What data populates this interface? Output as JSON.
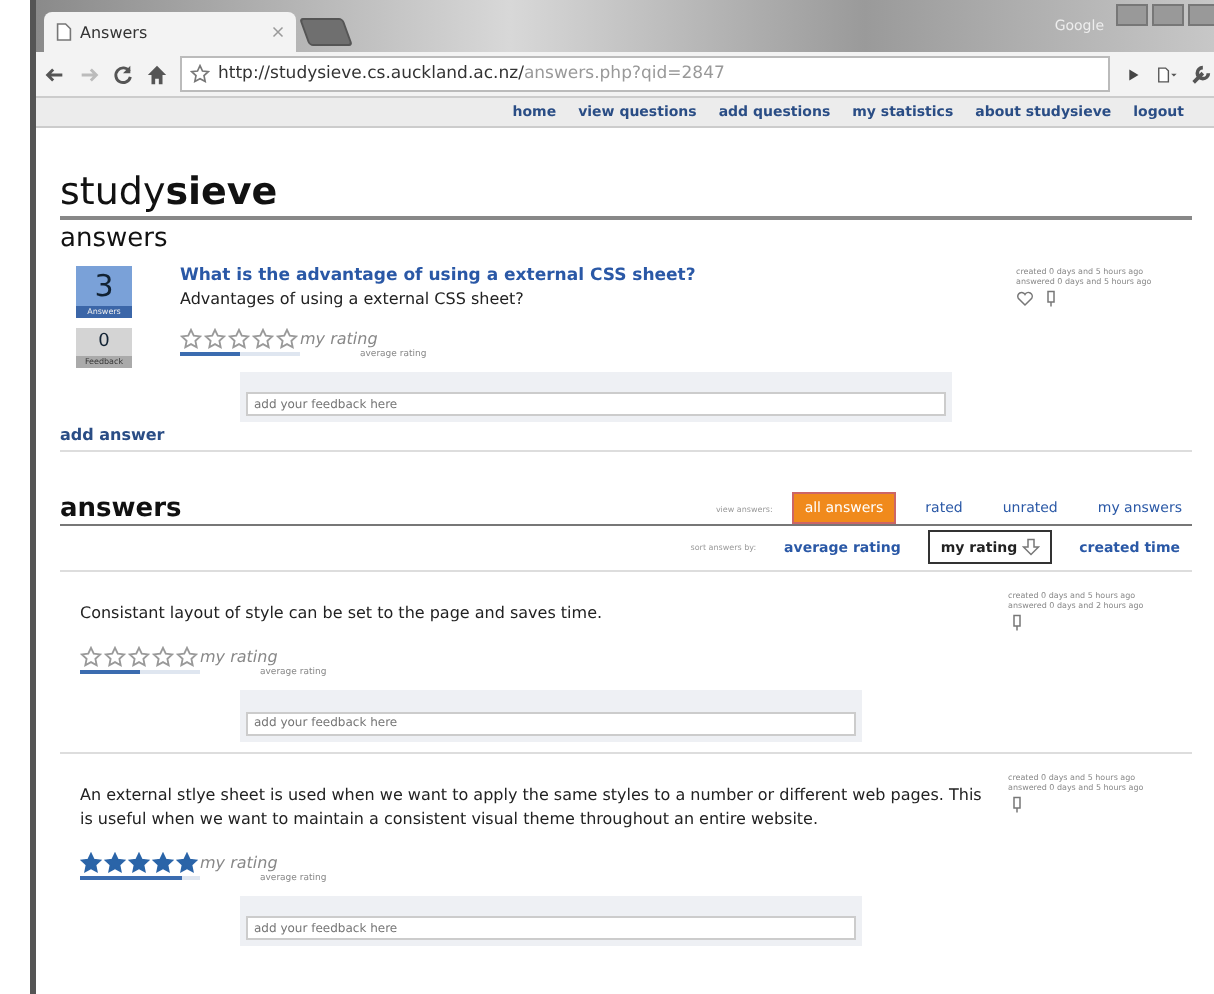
{
  "browser": {
    "tab_title": "Answers",
    "profile_label": "Google",
    "url_host": "http://studysieve.cs.auckland.ac.nz/",
    "url_path": "answers.php?qid=2847"
  },
  "nav": [
    "home",
    "view questions",
    "add questions",
    "my statistics",
    "about studysieve",
    "logout"
  ],
  "logo": "study**sieve**",
  "question_section": {
    "heading": "answers",
    "answers_count": "3",
    "answers_label": "Answers",
    "feedback_count": "0",
    "feedback_label": "Feedback",
    "title": "What is the advantage of using a external CSS sheet?",
    "body": "Advantages of using a external CSS sheet?",
    "meta": [
      "created 0 days and 5 hours ago",
      "answered 0 days and 5 hours ago"
    ],
    "stars": 0,
    "rating_label": "my rating",
    "avg_label": "average rating",
    "level": 0.5,
    "feedback": {
      "placeholder": "add your feedback here"
    },
    "add_answer": "add answer"
  },
  "answers_section": {
    "heading": "answers",
    "view_label": "view answers:",
    "view_tabs": [
      {
        "label": "all answers",
        "selected": true
      },
      {
        "label": "rated",
        "selected": false
      },
      {
        "label": "unrated",
        "selected": false
      },
      {
        "label": "my answers",
        "selected": false
      }
    ],
    "sort_label": "sort answers by:",
    "sort_options": [
      {
        "label": "average rating",
        "selected": false
      },
      {
        "label": "my rating",
        "selected": true
      },
      {
        "label": "created time",
        "selected": false
      }
    ],
    "answers": [
      {
        "text": "Consistant layout of style can be set to the page and saves time.",
        "meta": [
          "created 0 days and 5 hours ago",
          "answered 0 days and 2 hours ago"
        ],
        "stars": 0,
        "rating_label": "my rating",
        "avg_label": "average rating",
        "level": 0.5,
        "feedback": {
          "placeholder": "add your feedback here"
        }
      },
      {
        "text": "An external stlye sheet is used when we want to apply the same styles to a number or different web pages. This is useful when we want to maintain a consistent visual theme throughout an entire website.",
        "meta": [
          "created 0 days and 5 hours ago",
          "answered 0 days and 5 hours ago"
        ],
        "stars": 5,
        "rating_label": "my rating",
        "avg_label": "average rating",
        "level": 0.85,
        "feedback": {
          "placeholder": "add your feedback here"
        }
      }
    ]
  }
}
